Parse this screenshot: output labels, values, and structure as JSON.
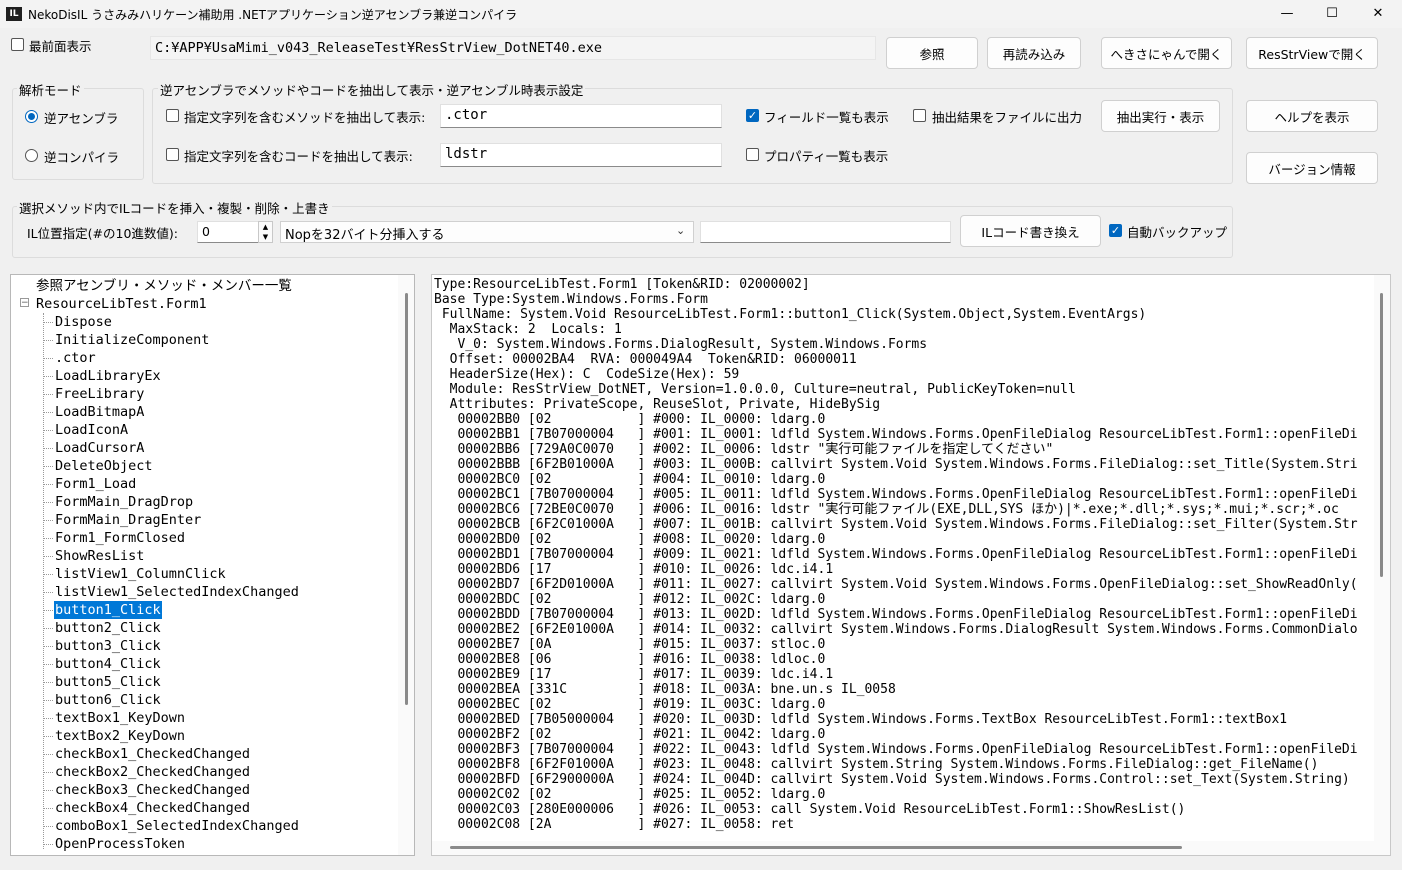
{
  "window": {
    "title": "NekoDisIL うさみみハリケーン補助用 .NETアプリケーション逆アセンブラ兼逆コンパイラ",
    "icon_text": "IL",
    "minimize": "—",
    "maximize": "☐",
    "close": "✕"
  },
  "top": {
    "topmost_label": "最前面表示",
    "topmost_checked": false,
    "file_path": "C:¥APP¥UsaMimi_v043_ReleaseTest¥ResStrView_DotNET40.exe",
    "browse_button": "参照",
    "reload_button": "再読み込み",
    "open_hekisa_button": "へきさにゃんで開く",
    "open_resstrview_button": "ResStrViewで開く"
  },
  "analysis_mode": {
    "group_label": "解析モード",
    "disassembler": "逆アセンブラ",
    "decompiler": "逆コンパイラ",
    "selected": "逆アセンブラ"
  },
  "extract": {
    "group_label": "逆アセンブラでメソッドやコードを抽出して表示・逆アセンブル時表示設定",
    "method_filter_label": "指定文字列を含むメソッドを抽出して表示:",
    "method_filter_value": ".ctor",
    "code_filter_label": "指定文字列を含むコードを抽出して表示:",
    "code_filter_value": "ldstr",
    "show_fields_label": "フィールド一覧も表示",
    "show_fields_checked": true,
    "show_properties_label": "プロパティ一覧も表示",
    "output_file_label": "抽出結果をファイルに出力",
    "run_button": "抽出実行・表示"
  },
  "side_buttons": {
    "help": "ヘルプを表示",
    "version": "バージョン情報"
  },
  "il_edit": {
    "group_label": "選択メソッド内でILコードを挿入・複製・削除・上書き",
    "position_label": "IL位置指定(#の10進数値):",
    "position_value": "0",
    "operation_value": "Nopを32バイト分挿入する",
    "extra_value": "",
    "rewrite_button": "ILコード書き換え",
    "auto_backup_label": "自動バックアップ",
    "auto_backup_checked": true
  },
  "tree": {
    "root": "参照アセンブリ・メソッド・メンバー一覧",
    "class": "ResourceLibTest.Form1",
    "selected": "button1_Click",
    "items": [
      "Dispose",
      "InitializeComponent",
      ".ctor",
      "LoadLibraryEx",
      "FreeLibrary",
      "LoadBitmapA",
      "LoadIconA",
      "LoadCursorA",
      "DeleteObject",
      "Form1_Load",
      "FormMain_DragDrop",
      "FormMain_DragEnter",
      "Form1_FormClosed",
      "ShowResList",
      "listView1_ColumnClick",
      "listView1_SelectedIndexChanged",
      "button1_Click",
      "button2_Click",
      "button3_Click",
      "button4_Click",
      "button5_Click",
      "button6_Click",
      "textBox1_KeyDown",
      "textBox2_KeyDown",
      "checkBox1_CheckedChanged",
      "checkBox2_CheckedChanged",
      "checkBox3_CheckedChanged",
      "checkBox4_CheckedChanged",
      "comboBox1_SelectedIndexChanged",
      "OpenProcessToken"
    ]
  },
  "code": {
    "lines": [
      "Type:ResourceLibTest.Form1 [Token&RID: 02000002]",
      "Base Type:System.Windows.Forms.Form",
      " FullName: System.Void ResourceLibTest.Form1::button1_Click(System.Object,System.EventArgs)",
      "  MaxStack: 2  Locals: 1",
      "   V_0: System.Windows.Forms.DialogResult, System.Windows.Forms",
      "  Offset: 00002BA4  RVA: 000049A4  Token&RID: 06000011",
      "  HeaderSize(Hex): C  CodeSize(Hex): 59",
      "  Module: ResStrView_DotNET, Version=1.0.0.0, Culture=neutral, PublicKeyToken=null",
      "  Attributes: PrivateScope, ReuseSlot, Private, HideBySig",
      "   00002BB0 [02           ] #000: IL_0000: ldarg.0",
      "   00002BB1 [7B07000004   ] #001: IL_0001: ldfld System.Windows.Forms.OpenFileDialog ResourceLibTest.Form1::openFileDi",
      "   00002BB6 [729A0C0070   ] #002: IL_0006: ldstr \"実行可能ファイルを指定してください\"",
      "   00002BBB [6F2B01000A   ] #003: IL_000B: callvirt System.Void System.Windows.Forms.FileDialog::set_Title(System.Stri",
      "   00002BC0 [02           ] #004: IL_0010: ldarg.0",
      "   00002BC1 [7B07000004   ] #005: IL_0011: ldfld System.Windows.Forms.OpenFileDialog ResourceLibTest.Form1::openFileDi",
      "   00002BC6 [72BE0C0070   ] #006: IL_0016: ldstr \"実行可能ファイル(EXE,DLL,SYS ほか)|*.exe;*.dll;*.sys;*.mui;*.scr;*.oc",
      "   00002BCB [6F2C01000A   ] #007: IL_001B: callvirt System.Void System.Windows.Forms.FileDialog::set_Filter(System.Str",
      "   00002BD0 [02           ] #008: IL_0020: ldarg.0",
      "   00002BD1 [7B07000004   ] #009: IL_0021: ldfld System.Windows.Forms.OpenFileDialog ResourceLibTest.Form1::openFileDi",
      "   00002BD6 [17           ] #010: IL_0026: ldc.i4.1",
      "   00002BD7 [6F2D01000A   ] #011: IL_0027: callvirt System.Void System.Windows.Forms.OpenFileDialog::set_ShowReadOnly(",
      "   00002BDC [02           ] #012: IL_002C: ldarg.0",
      "   00002BDD [7B07000004   ] #013: IL_002D: ldfld System.Windows.Forms.OpenFileDialog ResourceLibTest.Form1::openFileDi",
      "   00002BE2 [6F2E01000A   ] #014: IL_0032: callvirt System.Windows.Forms.DialogResult System.Windows.Forms.CommonDialo",
      "   00002BE7 [0A           ] #015: IL_0037: stloc.0",
      "   00002BE8 [06           ] #016: IL_0038: ldloc.0",
      "   00002BE9 [17           ] #017: IL_0039: ldc.i4.1",
      "   00002BEA [331C         ] #018: IL_003A: bne.un.s IL_0058",
      "   00002BEC [02           ] #019: IL_003C: ldarg.0",
      "   00002BED [7B05000004   ] #020: IL_003D: ldfld System.Windows.Forms.TextBox ResourceLibTest.Form1::textBox1",
      "   00002BF2 [02           ] #021: IL_0042: ldarg.0",
      "   00002BF3 [7B07000004   ] #022: IL_0043: ldfld System.Windows.Forms.OpenFileDialog ResourceLibTest.Form1::openFileDi",
      "   00002BF8 [6F2F01000A   ] #023: IL_0048: callvirt System.String System.Windows.Forms.FileDialog::get_FileName()",
      "   00002BFD [6F2900000A   ] #024: IL_004D: callvirt System.Void System.Windows.Forms.Control::set_Text(System.String)",
      "   00002C02 [02           ] #025: IL_0052: ldarg.0",
      "   00002C03 [280E000006   ] #026: IL_0053: call System.Void ResourceLibTest.Form1::ShowResList()",
      "   00002C08 [2A           ] #027: IL_0058: ret"
    ]
  }
}
